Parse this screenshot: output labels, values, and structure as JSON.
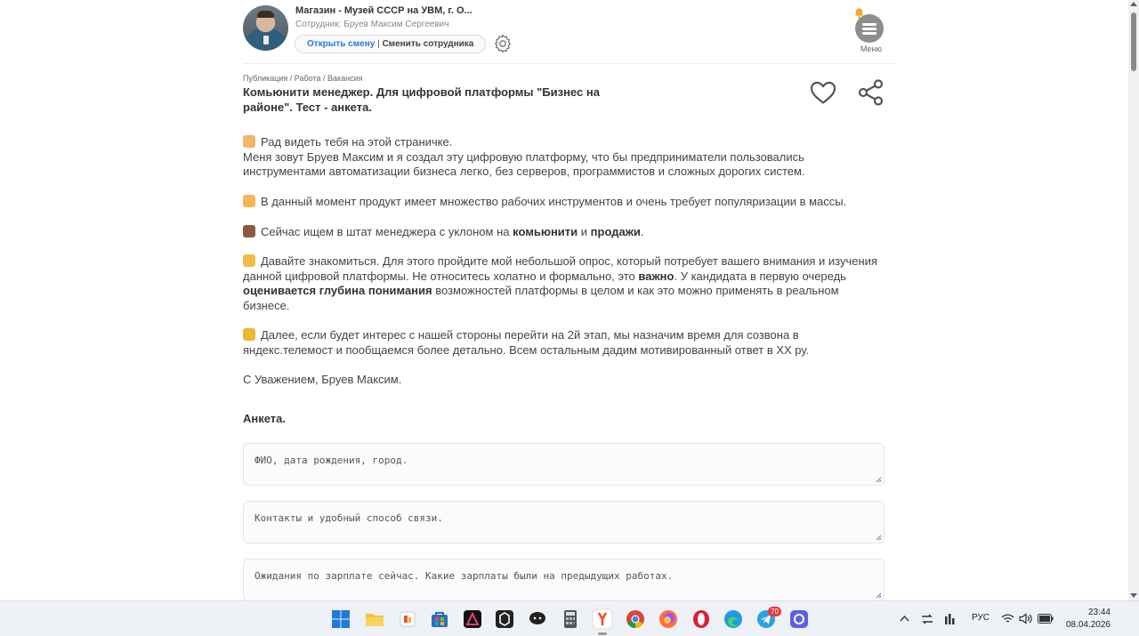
{
  "header": {
    "shop_name": "Магазин - Музей СССР на УВМ, г. О...",
    "employee": "Сотрудник: Бруев Максим Сергеевич",
    "open_shift": "Открыть смену",
    "separator": "|",
    "change_employee": "Сменить сотрудника",
    "menu_label": "Меню"
  },
  "post": {
    "breadcrumb": "Публикация / Работа / Вакансия",
    "title": "Комьюнити менеджер. Для цифровой платформы \"Бизнес на районе\". Тест - анкета."
  },
  "body": {
    "p1_line1": "Рад видеть тебя на этой страничке.",
    "p1_line2": "Меня зовут Бруев Максим и я создал эту цифровую платформу, что бы предприниматели пользовались инструментами автоматизации бизнеса легко, без серверов, программистов и сложных дорогих систем.",
    "p2": "В данный момент продукт имеет множество рабочих инструментов и очень требует популяризации в массы.",
    "p3_a": "Сейчас ищем в штат менеджера с уклоном на ",
    "p3_b": "комьюнити",
    "p3_c": " и ",
    "p3_d": "продажи",
    "p3_e": ".",
    "p4_a": "Давайте знакомиться. Для этого пройдите мой небольшой опрос, который потребует вашего внимания и изучения данной цифровой платформы. Не относитесь холатно и формально, это ",
    "p4_b": "важно",
    "p4_c": ". У кандидата в первую очередь ",
    "p4_d": "оценивается глубина понимания",
    "p4_e": " возможностей платформы в целом и как это можно применять в реальном бизнесе.",
    "p5": "Далее, если будет интерес с нашей стороны перейти на 2й этап, мы назначим время для созвона в яндекс.телемост и пообщаемся более детально. Всем остальным дадим мотивированный ответ в XX ру.",
    "signature": "С Уважением, Бруев Максим."
  },
  "form": {
    "heading": "Анкета.",
    "fields": [
      {
        "placeholder": "ФИО, дата рождения, город.",
        "value": ""
      },
      {
        "placeholder": "Контакты и удобный способ связи.",
        "value": ""
      },
      {
        "placeholder": "Ожидания по зарплате сейчас. Какие зарплаты были на предыдущих работах.",
        "value": ""
      }
    ]
  },
  "taskbar": {
    "apps": [
      "windows-start",
      "file-explorer",
      "app-orange",
      "microsoft-store",
      "app-delta",
      "app-box",
      "app-chat",
      "calculator",
      "yandex-browser",
      "chrome",
      "firefox",
      "opera",
      "edge",
      "telegram",
      "app-square"
    ],
    "telegram_badge": "70",
    "language": "РУС",
    "time": "23:44",
    "date": "08.04.2026"
  },
  "colors": {
    "link": "#2a7ad8",
    "text": "#444444",
    "taskbar": "#eef1f6"
  }
}
